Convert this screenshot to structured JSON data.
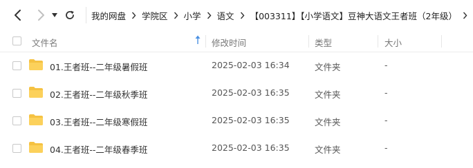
{
  "nav": {
    "breadcrumbs": [
      "我的网盘",
      "学院区",
      "小学",
      "语文",
      "【003311】【小学语文】豆神大语文王者班（2年级）"
    ]
  },
  "table": {
    "columns": {
      "name": "文件名",
      "modified": "修改时间",
      "type": "类型",
      "size": "大小"
    },
    "sort": {
      "column": "name",
      "direction": "ascending",
      "icon": "sort-up-arrow-icon"
    },
    "rows": [
      {
        "name": "01.王者班--二年级暑假班",
        "modified": "2025-02-03 16:34",
        "type": "文件夹",
        "size": "-"
      },
      {
        "name": "02.王者班--二年级秋季班",
        "modified": "2025-02-03 16:35",
        "type": "文件夹",
        "size": "-"
      },
      {
        "name": "03.王者班--二年级寒假班",
        "modified": "2025-02-03 16:35",
        "type": "文件夹",
        "size": "-"
      },
      {
        "name": "04.王者班--二年级春季班",
        "modified": "2025-02-03 16:35",
        "type": "文件夹",
        "size": "-"
      }
    ]
  },
  "icons": {
    "back": "chevron-left-icon",
    "forward": "chevron-right-icon",
    "history": "caret-down-icon",
    "refresh": "refresh-icon",
    "folder": "folder-icon"
  },
  "colors": {
    "folder": "#f5c242",
    "sort_arrow": "#4a90e2",
    "forward_disabled": "#c0c0c0"
  }
}
